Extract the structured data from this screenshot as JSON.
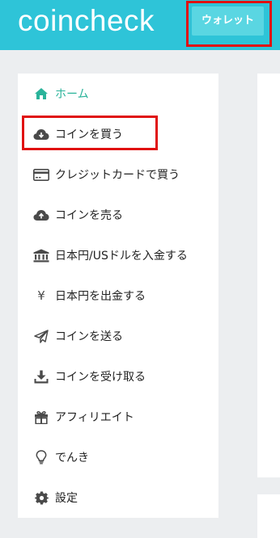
{
  "header": {
    "logo": "coincheck",
    "wallet_button": "ウォレット"
  },
  "sidebar": {
    "items": [
      {
        "label": "ホーム",
        "icon": "home-icon"
      },
      {
        "label": "コインを買う",
        "icon": "cloud-download-icon"
      },
      {
        "label": "クレジットカードで買う",
        "icon": "credit-card-icon"
      },
      {
        "label": "コインを売る",
        "icon": "cloud-upload-icon"
      },
      {
        "label": "日本円/USドルを入金する",
        "icon": "bank-icon"
      },
      {
        "label": "日本円を出金する",
        "icon": "yen-icon"
      },
      {
        "label": "コインを送る",
        "icon": "paper-plane-icon"
      },
      {
        "label": "コインを受け取る",
        "icon": "download-tray-icon"
      },
      {
        "label": "アフィリエイト",
        "icon": "gift-icon"
      },
      {
        "label": "でんき",
        "icon": "lightbulb-icon"
      },
      {
        "label": "設定",
        "icon": "gear-icon"
      }
    ]
  },
  "colors": {
    "header_bg": "#2ec4d8",
    "active": "#2ab39a",
    "highlight": "#e01010"
  },
  "yen_glyph": "¥"
}
